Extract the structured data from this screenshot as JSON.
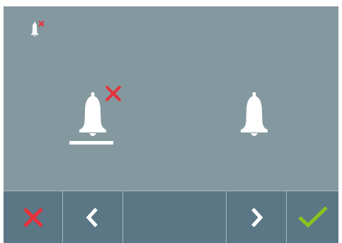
{
  "screen": {
    "status_icon": "bell-muted-icon",
    "options": [
      {
        "name": "bell-muted",
        "icon": "bell-muted-icon",
        "selected": true
      },
      {
        "name": "bell-ring",
        "icon": "bell-icon",
        "selected": false
      }
    ]
  },
  "toolbar": {
    "buttons": [
      {
        "name": "cancel-button",
        "icon": "close-icon",
        "color": "#e5323b"
      },
      {
        "name": "previous-button",
        "icon": "chevron-left-icon",
        "color": "#ffffff"
      },
      {
        "name": "next-button",
        "icon": "chevron-right-icon",
        "color": "#ffffff"
      },
      {
        "name": "confirm-button",
        "icon": "checkmark-icon",
        "color": "#8dc21f"
      }
    ]
  },
  "colors": {
    "background": "#84989f",
    "toolbar": "#5b7685",
    "separator": "#a9b9c0",
    "icon": "#ffffff",
    "cancel": "#e5323b",
    "confirm": "#8dc21f"
  }
}
